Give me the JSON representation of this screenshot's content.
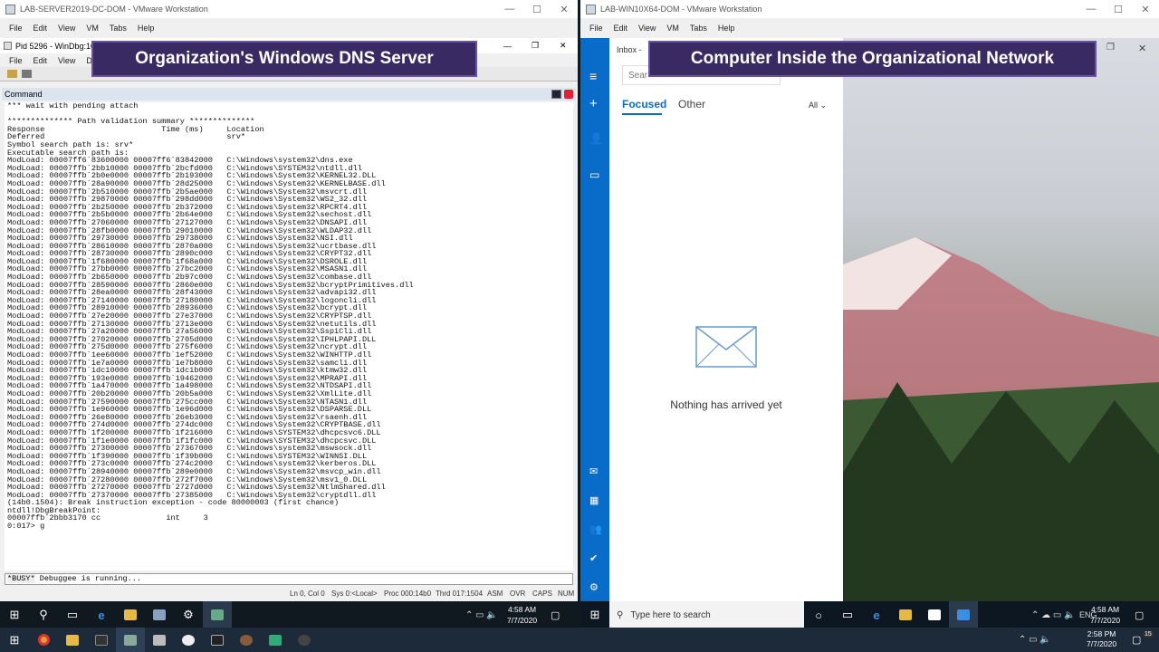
{
  "left_vm": {
    "title": "LAB-SERVER2019-DC-DOM - VMware Workstation",
    "menu": [
      "File",
      "Edit",
      "View",
      "VM",
      "Tabs",
      "Help"
    ],
    "windbg": {
      "title": "Pid 5296 - WinDbg:10.0.",
      "menu": [
        "File",
        "Edit",
        "View",
        "Debug"
      ],
      "command_label": "Command",
      "lines": [
        "*** wait with pending attach",
        "",
        "************** Path validation summary **************",
        "Response                         Time (ms)     Location",
        "Deferred                                       srv*",
        "Symbol search path is: srv*",
        "Executable search path is:",
        "ModLoad: 00007ff6`83600000 00007ff6`83842000   C:\\Windows\\system32\\dns.exe",
        "ModLoad: 00007ffb`2bb10000 00007ffb`2bcfd000   C:\\Windows\\SYSTEM32\\ntdll.dll",
        "ModLoad: 00007ffb`2b0e0000 00007ffb`2b193000   C:\\Windows\\System32\\KERNEL32.DLL",
        "ModLoad: 00007ffb`28a90000 00007ffb`28d25000   C:\\Windows\\System32\\KERNELBASE.dll",
        "ModLoad: 00007ffb`2b510000 00007ffb`2b5ae000   C:\\Windows\\System32\\msvcrt.dll",
        "ModLoad: 00007ffb`29870000 00007ffb`298dd000   C:\\Windows\\System32\\WS2_32.dll",
        "ModLoad: 00007ffb`2b250000 00007ffb`2b372000   C:\\Windows\\System32\\RPCRT4.dll",
        "ModLoad: 00007ffb`2b5b0000 00007ffb`2b64e000   C:\\Windows\\System32\\sechost.dll",
        "ModLoad: 00007ffb`27060000 00007ffb`27127000   C:\\Windows\\System32\\DNSAPI.dll",
        "ModLoad: 00007ffb`28fb0000 00007ffb`29010000   C:\\Windows\\System32\\WLDAP32.dll",
        "ModLoad: 00007ffb`29730000 00007ffb`29738000   C:\\Windows\\System32\\NSI.dll",
        "ModLoad: 00007ffb`28610000 00007ffb`2870a000   C:\\Windows\\System32\\ucrtbase.dll",
        "ModLoad: 00007ffb`28730000 00007ffb`2890c000   C:\\Windows\\System32\\CRYPT32.dll",
        "ModLoad: 00007ffb`1f680000 00007ffb`1f68a000   C:\\Windows\\System32\\DSROLE.dll",
        "ModLoad: 00007ffb`27bb0000 00007ffb`27bc2000   C:\\Windows\\System32\\MSASN1.dll",
        "ModLoad: 00007ffb`2b650000 00007ffb`2b97c000   C:\\Windows\\System32\\combase.dll",
        "ModLoad: 00007ffb`28590000 00007ffb`2860e000   C:\\Windows\\System32\\bcryptPrimitives.dll",
        "ModLoad: 00007ffb`28ea0000 00007ffb`28f43000   C:\\Windows\\System32\\advapi32.dll",
        "ModLoad: 00007ffb`27140000 00007ffb`27180000   C:\\Windows\\System32\\logoncli.dll",
        "ModLoad: 00007ffb`28910000 00007ffb`28936000   C:\\Windows\\System32\\bcrypt.dll",
        "ModLoad: 00007ffb`27e20000 00007ffb`27e37000   C:\\Windows\\System32\\CRYPTSP.dll",
        "ModLoad: 00007ffb`27130000 00007ffb`2713e000   C:\\Windows\\System32\\netutils.dll",
        "ModLoad: 00007ffb`27a20000 00007ffb`27a56000   C:\\Windows\\System32\\SspiCli.dll",
        "ModLoad: 00007ffb`27020000 00007ffb`2705d000   C:\\Windows\\System32\\IPHLPAPI.DLL",
        "ModLoad: 00007ffb`275d0000 00007ffb`275f6000   C:\\Windows\\System32\\ncrypt.dll",
        "ModLoad: 00007ffb`1ee60000 00007ffb`1ef52000   C:\\Windows\\System32\\WINHTTP.dll",
        "ModLoad: 00007ffb`1e7a0000 00007ffb`1e7b8000   C:\\Windows\\System32\\samcli.dll",
        "ModLoad: 00007ffb`1dc10000 00007ffb`1dc1b000   C:\\Windows\\System32\\ktmw32.dll",
        "ModLoad: 00007ffb`193e0000 00007ffb`19462000   C:\\Windows\\System32\\MPRAPI.dll",
        "ModLoad: 00007ffb`1a470000 00007ffb`1a498000   C:\\Windows\\System32\\NTDSAPI.dll",
        "ModLoad: 00007ffb`20b20000 00007ffb`20b5a000   C:\\Windows\\System32\\XmlLite.dll",
        "ModLoad: 00007ffb`27590000 00007ffb`275cc000   C:\\Windows\\System32\\NTASN1.dll",
        "ModLoad: 00007ffb`1e960000 00007ffb`1e96d000   C:\\Windows\\System32\\DSPARSE.DLL",
        "ModLoad: 00007ffb`26e80000 00007ffb`26eb3000   C:\\Windows\\System32\\rsaenh.dll",
        "ModLoad: 00007ffb`274d0000 00007ffb`274dc000   C:\\Windows\\System32\\CRYPTBASE.dll",
        "ModLoad: 00007ffb`1f200000 00007ffb`1f216000   C:\\Windows\\SYSTEM32\\dhcpcsvc6.DLL",
        "ModLoad: 00007ffb`1f1e0000 00007ffb`1f1fc000   C:\\Windows\\SYSTEM32\\dhcpcsvc.DLL",
        "ModLoad: 00007ffb`27300000 00007ffb`27367000   C:\\Windows\\system32\\mswsock.dll",
        "ModLoad: 00007ffb`1f390000 00007ffb`1f39b000   C:\\Windows\\SYSTEM32\\WINNSI.DLL",
        "ModLoad: 00007ffb`273c0000 00007ffb`274c2000   C:\\Windows\\system32\\kerberos.DLL",
        "ModLoad: 00007ffb`28940000 00007ffb`289e0000   C:\\Windows\\System32\\msvcp_win.dll",
        "ModLoad: 00007ffb`27280000 00007ffb`272f7000   C:\\Windows\\System32\\msv1_0.DLL",
        "ModLoad: 00007ffb`27270000 00007ffb`2727d000   C:\\Windows\\System32\\NtlmShared.dll",
        "ModLoad: 00007ffb`27370000 00007ffb`27385000   C:\\Windows\\System32\\cryptdll.dll",
        "(14b0.1504): Break instruction exception - code 80000003 (first chance)",
        "ntdll!DbgBreakPoint:",
        "00007ffb`2bbb3170 cc              int     3",
        "0:017> g"
      ],
      "busy_label": "*BUSY*",
      "busy_text": "Debuggee is running...",
      "status": [
        "Ln 0, Col 0",
        "Sys 0:<Local>",
        "Proc 000:14b0",
        "Thrd 017:1504",
        "ASM",
        "OVR",
        "CAPS",
        "NUM"
      ]
    },
    "clock_time": "4:58 AM",
    "clock_date": "7/7/2020"
  },
  "right_vm": {
    "title": "LAB-WIN10X64-DOM - VMware Workstation",
    "menu": [
      "File",
      "Edit",
      "View",
      "VM",
      "Tabs",
      "Help"
    ],
    "mail": {
      "inbox_label": "Inbox - ",
      "search_placeholder": "Sear",
      "tab_focused": "Focused",
      "tab_other": "Other",
      "filter": "All",
      "empty_text": "Nothing has arrived yet"
    },
    "taskbar_search": "Type here to search",
    "lang": "ENG",
    "clock_time": "4:58 AM",
    "clock_date": "7/7/2020"
  },
  "overlays": {
    "left": "Organization's Windows DNS Server",
    "right": "Computer Inside the Organizational Network"
  },
  "host": {
    "clock_time": "2:58 PM",
    "clock_date": "7/7/2020",
    "notif_count": "15"
  }
}
